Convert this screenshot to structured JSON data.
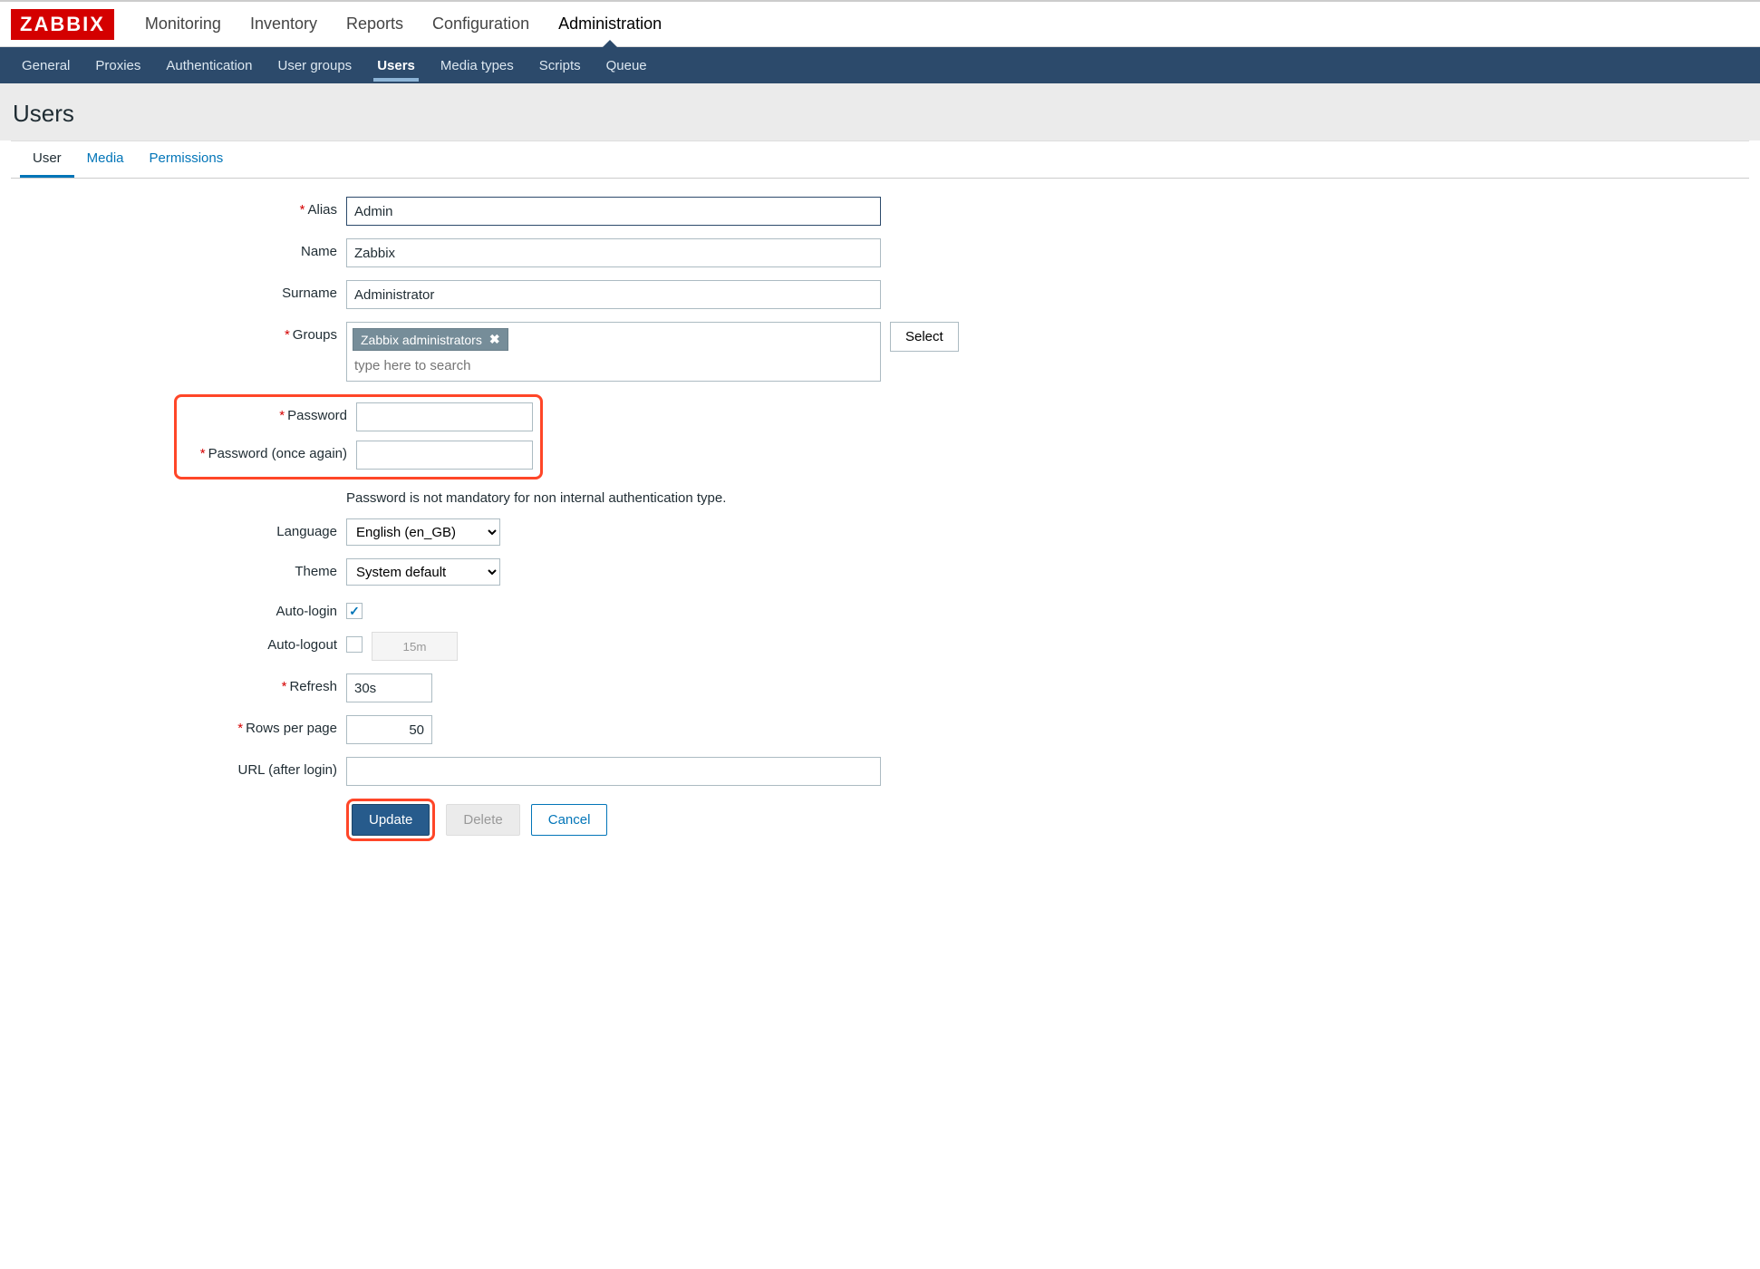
{
  "logo": "ZABBIX",
  "topnav": {
    "items": [
      {
        "label": "Monitoring"
      },
      {
        "label": "Inventory"
      },
      {
        "label": "Reports"
      },
      {
        "label": "Configuration"
      },
      {
        "label": "Administration",
        "active": true
      }
    ]
  },
  "subnav": {
    "items": [
      {
        "label": "General"
      },
      {
        "label": "Proxies"
      },
      {
        "label": "Authentication"
      },
      {
        "label": "User groups"
      },
      {
        "label": "Users",
        "active": true
      },
      {
        "label": "Media types"
      },
      {
        "label": "Scripts"
      },
      {
        "label": "Queue"
      }
    ]
  },
  "page": {
    "title": "Users"
  },
  "tabs": [
    {
      "label": "User",
      "active": true
    },
    {
      "label": "Media"
    },
    {
      "label": "Permissions"
    }
  ],
  "form": {
    "alias": {
      "label": "Alias",
      "value": "Admin",
      "required": true
    },
    "name": {
      "label": "Name",
      "value": "Zabbix"
    },
    "surname": {
      "label": "Surname",
      "value": "Administrator"
    },
    "groups": {
      "label": "Groups",
      "required": true,
      "tags": [
        "Zabbix administrators"
      ],
      "placeholder": "type here to search",
      "select_label": "Select"
    },
    "password": {
      "label": "Password",
      "required": true,
      "value": ""
    },
    "password2": {
      "label": "Password (once again)",
      "required": true,
      "value": ""
    },
    "password_help": "Password is not mandatory for non internal authentication type.",
    "language": {
      "label": "Language",
      "value": "English (en_GB)"
    },
    "theme": {
      "label": "Theme",
      "value": "System default"
    },
    "autologin": {
      "label": "Auto-login",
      "checked": true
    },
    "autologout": {
      "label": "Auto-logout",
      "checked": false,
      "value": "15m"
    },
    "refresh": {
      "label": "Refresh",
      "required": true,
      "value": "30s"
    },
    "rows": {
      "label": "Rows per page",
      "required": true,
      "value": "50"
    },
    "url": {
      "label": "URL (after login)",
      "value": ""
    }
  },
  "buttons": {
    "update": "Update",
    "delete": "Delete",
    "cancel": "Cancel"
  }
}
